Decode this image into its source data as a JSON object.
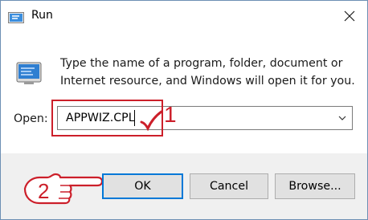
{
  "window": {
    "title": "Run",
    "description": "Type the name of a program, folder, document or Internet resource, and Windows will open it for you."
  },
  "open": {
    "label": "Open:",
    "value": "APPWIZ.CPL"
  },
  "buttons": {
    "ok": "OK",
    "cancel": "Cancel",
    "browse": "Browse..."
  },
  "annotations": {
    "step1": "1",
    "step2": "2",
    "color": "#cc1f2a"
  },
  "icons": [
    "run-app-icon",
    "close-icon",
    "run-program-icon",
    "dropdown-arrow-icon",
    "checkmark-icon",
    "pointing-hand-icon"
  ]
}
